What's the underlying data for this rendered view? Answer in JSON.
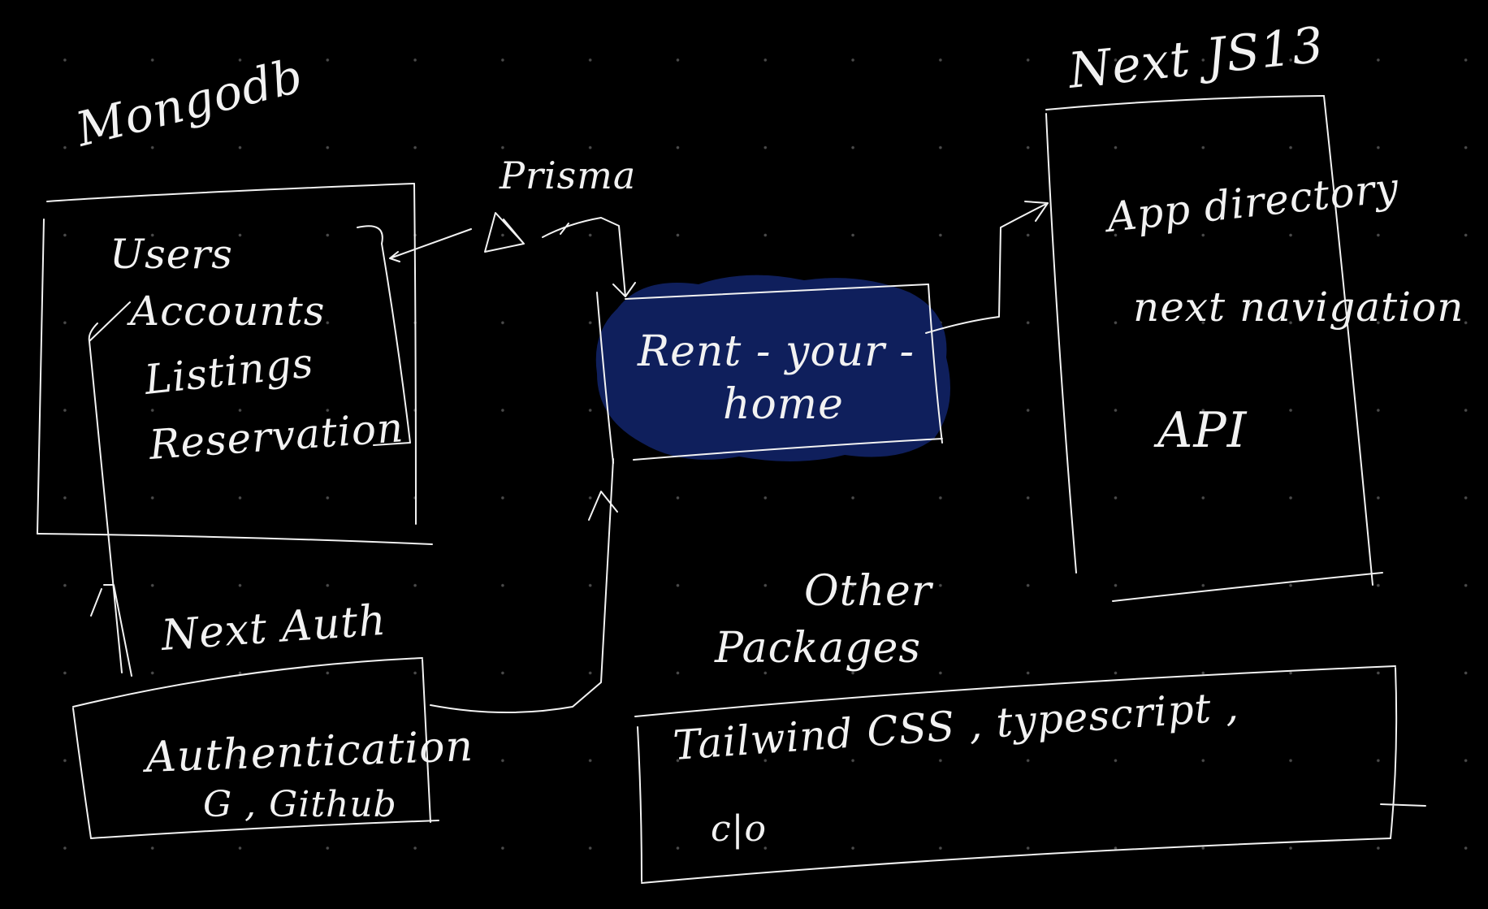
{
  "colors": {
    "background": "#000000",
    "ink": "#f2f2f2",
    "highlight": "#0f1f5c"
  },
  "mongodb": {
    "title": "Mongodb",
    "items": [
      "Users",
      "Accounts",
      "Listings",
      "Reservation"
    ]
  },
  "prisma": {
    "label": "Prisma"
  },
  "center": {
    "line1": "Rent - your -",
    "line2": "home"
  },
  "nextjs": {
    "title": "Next JS13",
    "items": [
      "App directory",
      "next navigation",
      "API"
    ]
  },
  "nextauth": {
    "title": "Next Auth",
    "line1": "Authentication",
    "line2": "G , Github"
  },
  "other": {
    "title_line1": "Other",
    "title_line2": "Packages",
    "line1": "Tailwind CSS ,  typescript ,",
    "line2": "c|o"
  }
}
